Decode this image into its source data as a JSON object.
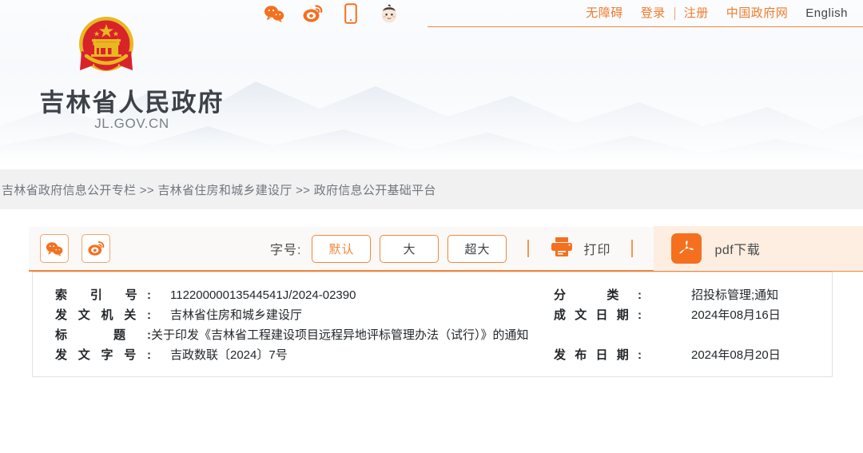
{
  "header": {
    "site_title": "吉林省人民政府",
    "site_domain": "JL.GOV.CN",
    "emblem_alt": "national-emblem",
    "social_icons": [
      {
        "name": "wechat-icon",
        "label": "微信"
      },
      {
        "name": "weibo-icon",
        "label": "微博"
      },
      {
        "name": "mobile-icon",
        "label": "手机版"
      },
      {
        "name": "mascot-icon",
        "label": "吉祥物"
      }
    ],
    "nav": [
      {
        "label": "无障碍",
        "style": "orange"
      },
      {
        "label": "登录",
        "style": "orange"
      },
      {
        "label": "注册",
        "style": "orange"
      },
      {
        "label": "中国政府网",
        "style": "orange"
      },
      {
        "label": "English",
        "style": "dark"
      }
    ]
  },
  "breadcrumb": {
    "text": "吉林省政府信息公开专栏 >> 吉林省住房和城乡建设厅 >> 政府信息公开基础平台",
    "items": [
      "吉林省政府信息公开专栏",
      "吉林省住房和城乡建设厅",
      "政府信息公开基础平台"
    ],
    "separator": ">>"
  },
  "toolbar": {
    "share": [
      {
        "name": "wechat-share-icon",
        "label": "微信分享"
      },
      {
        "name": "weibo-share-icon",
        "label": "微博分享"
      }
    ],
    "fontsize_label": "字号:",
    "fontsize_options": [
      {
        "label": "默认",
        "active": true
      },
      {
        "label": "大",
        "active": false
      },
      {
        "label": "超大",
        "active": false
      }
    ],
    "print_label": "打印",
    "pdf_label": "pdf下载"
  },
  "info": {
    "rows": [
      {
        "left_label": "索 引 号:",
        "left_value": "11220000013544541J/2024-02390",
        "right_label": "分 类:",
        "right_value": "招投标管理;通知"
      },
      {
        "left_label": "发文机关:",
        "left_value": "吉林省住房和城乡建设厅",
        "right_label": "成文日期:",
        "right_value": "2024年08月16日"
      },
      {
        "left_label": "标 题:",
        "left_value": "关于印发《吉林省工程建设项目远程异地评标管理办法（试行）》的通知",
        "right_label": "",
        "right_value": ""
      },
      {
        "left_label": "发文字号:",
        "left_value": "吉政数联〔2024〕7号",
        "right_label": "发布日期:",
        "right_value": "2024年08月20日"
      }
    ]
  },
  "colors": {
    "accent_orange": "#f3873a",
    "accent_orange_strong": "#f4701f",
    "crumb_bg": "#f1f1f1",
    "toolbar_bg": "#faf9f7",
    "pdf_bg": "#fdeee1",
    "title_text": "#3d4248"
  }
}
